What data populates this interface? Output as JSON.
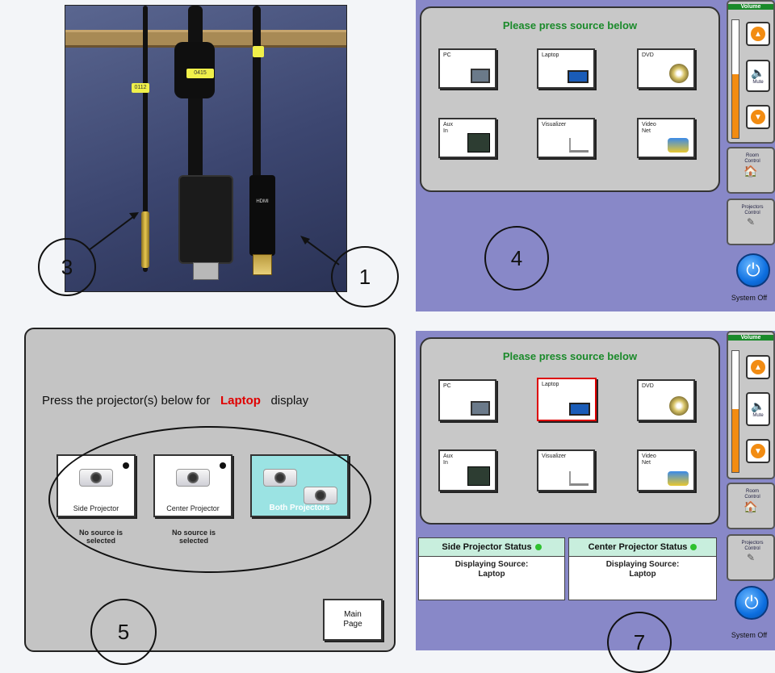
{
  "background": {
    "color": "#f3f5f8"
  },
  "photo": {
    "tags": [
      "0112",
      "0415",
      "HDMI"
    ],
    "callouts": [
      "3",
      "1"
    ]
  },
  "panel_top": {
    "title": "Please press source below",
    "sources": [
      {
        "label": "PC",
        "icon": "computer-icon",
        "selected": false
      },
      {
        "label": "Laptop",
        "icon": "laptop-icon",
        "selected": false
      },
      {
        "label": "DVD",
        "icon": "dvd-icon",
        "selected": false
      },
      {
        "label": "Aux In",
        "icon": "aux-icon",
        "selected": false
      },
      {
        "label": "Visualizer",
        "icon": "visualizer-icon",
        "selected": false
      },
      {
        "label": "Video Net",
        "icon": "videonet-icon",
        "selected": false
      }
    ],
    "sidebar": {
      "volume_label": "Volume",
      "mute_label": "Mute",
      "room_control": "Room Control",
      "projectors_control": "Projectors Control",
      "system_off": "System Off"
    },
    "callout": "4"
  },
  "panel_projectors": {
    "prompt_before": "Press the projector(s) below for",
    "source_name": "Laptop",
    "prompt_after": "display",
    "projectors": [
      {
        "label": "Side Projector",
        "status": "No source is selected"
      },
      {
        "label": "Center Projector",
        "status": "No source is selected"
      },
      {
        "label": "Both Projectors",
        "status": ""
      }
    ],
    "main_page": "Main Page",
    "callout": "5"
  },
  "panel_bottom": {
    "title": "Please press source below",
    "sources": [
      {
        "label": "PC",
        "selected": false
      },
      {
        "label": "Laptop",
        "selected": true
      },
      {
        "label": "DVD",
        "selected": false
      },
      {
        "label": "Aux In",
        "selected": false
      },
      {
        "label": "Visualizer",
        "selected": false
      },
      {
        "label": "Video Net",
        "selected": false
      }
    ],
    "status": [
      {
        "title": "Side Projector Status",
        "line1": "Displaying Source:",
        "line2": "Laptop"
      },
      {
        "title": "Center Projector Status",
        "line1": "Displaying Source:",
        "line2": "Laptop"
      }
    ],
    "sidebar": {
      "volume_label": "Volume",
      "mute_label": "Mute",
      "room_control": "Room Control",
      "projectors_control": "Projectors Control",
      "system_off": "System Off"
    },
    "callout": "7"
  },
  "colors": {
    "panel_blue": "#8888c8",
    "title_green": "#1a8a2a",
    "source_red": "#e00000",
    "power_blue": "#0d6fe0",
    "volume_orange": "#f28c12"
  }
}
